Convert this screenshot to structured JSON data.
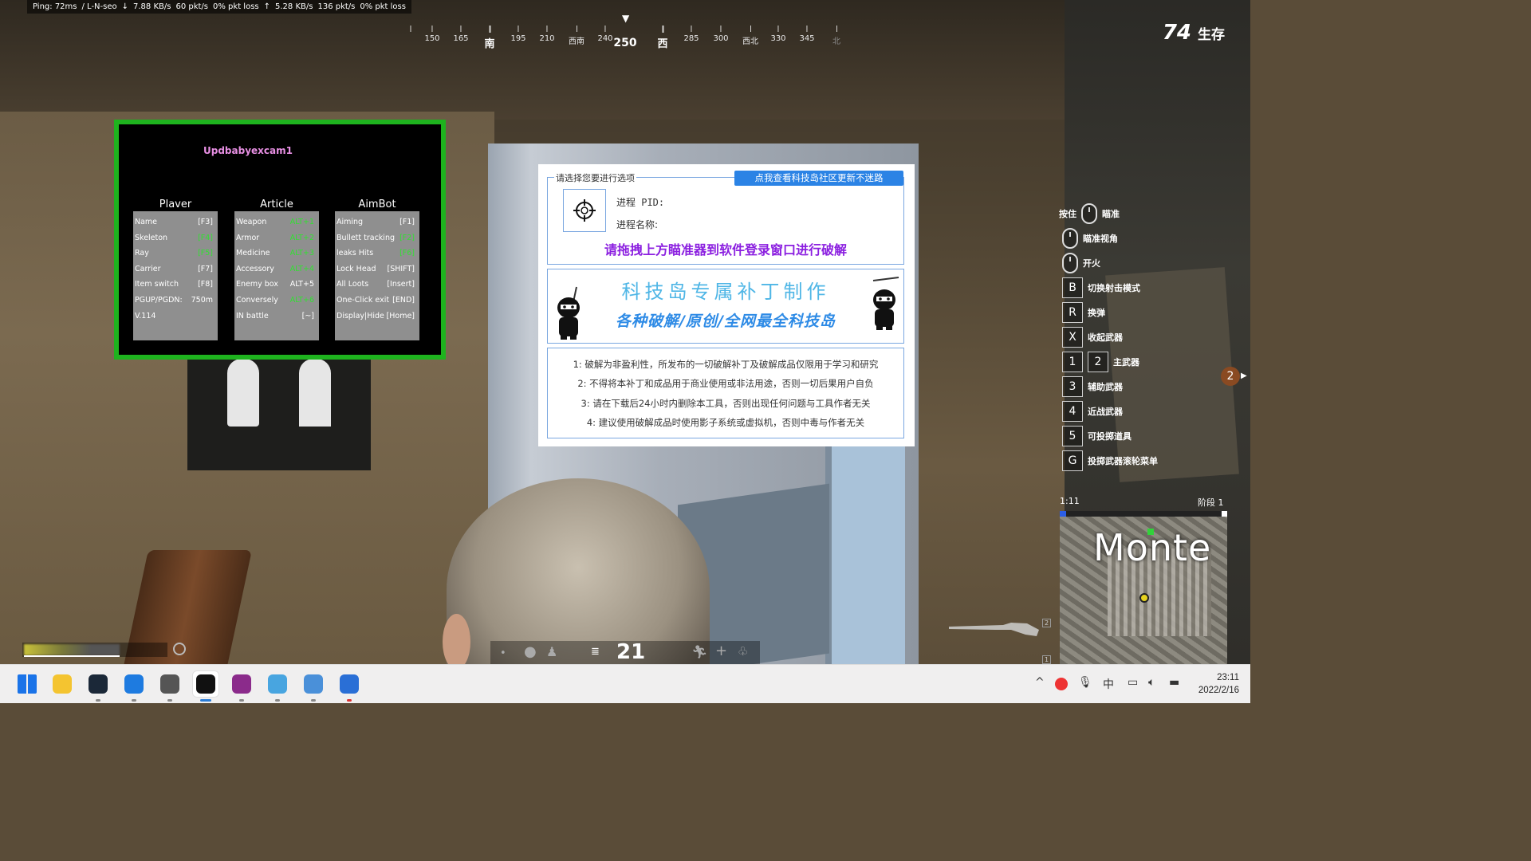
{
  "netstats": {
    "ping": "Ping: 72ms",
    "region": "/ L-N-seo",
    "down_icon": "down-arrow-icon",
    "down_rate": "7.88 KB/s",
    "down_pkt": "60 pkt/s",
    "down_loss": "0% pkt loss",
    "up_icon": "up-arrow-icon",
    "up_rate": "5.28 KB/s",
    "up_pkt": "136 pkt/s",
    "up_loss": "0% pkt loss"
  },
  "compass": {
    "heading": "250",
    "ticks": [
      {
        "label": "",
        "faded": true
      },
      {
        "label": "150"
      },
      {
        "label": "165"
      },
      {
        "label": "南",
        "major": true
      },
      {
        "label": "195"
      },
      {
        "label": "210"
      },
      {
        "label": "西南"
      },
      {
        "label": "240"
      },
      {
        "label": "西",
        "major": true
      },
      {
        "label": "285"
      },
      {
        "label": "300"
      },
      {
        "label": "西北"
      },
      {
        "label": "330"
      },
      {
        "label": "345"
      },
      {
        "label": "北",
        "faded": true
      }
    ]
  },
  "alive": {
    "count": "74",
    "label": "生存"
  },
  "cheat_menu": {
    "title": "Updbabyexcam1",
    "accent": "#1eb31e",
    "columns": [
      {
        "header": "Plaver",
        "rows": [
          {
            "name": "Name",
            "key": "[F3]",
            "green": false
          },
          {
            "name": "Skeleton",
            "key": "[F4]",
            "green": true
          },
          {
            "name": "Ray",
            "key": "[F5]",
            "green": true
          },
          {
            "name": "Carrier",
            "key": "[F7]",
            "green": false
          },
          {
            "name": "Item switch",
            "key": "[F8]",
            "green": false
          },
          {
            "name": "PGUP/PGDN:",
            "key": "750m",
            "green": false
          },
          {
            "name": "V.114",
            "key": "",
            "green": false
          }
        ]
      },
      {
        "header": "Article",
        "rows": [
          {
            "name": "Weapon",
            "key": "ALT+1",
            "green": true
          },
          {
            "name": "Armor",
            "key": "ALT+2",
            "green": true
          },
          {
            "name": "Medicine",
            "key": "ALT+3",
            "green": true
          },
          {
            "name": "Accessory",
            "key": "ALT+4",
            "green": true
          },
          {
            "name": "Enemy box",
            "key": "ALT+5",
            "green": false
          },
          {
            "name": "Conversely",
            "key": "ALT+6",
            "green": true
          },
          {
            "name": "IN battle",
            "key": "[~]",
            "green": false
          }
        ]
      },
      {
        "header": "AimBot",
        "rows": [
          {
            "name": "Aiming",
            "key": "[F1]",
            "green": false
          },
          {
            "name": "Bullett tracking",
            "key": "[F2]",
            "green": true
          },
          {
            "name": "leaks Hits",
            "key": "[F6]",
            "green": true
          },
          {
            "name": "Lock Head",
            "key": "[SHIFT]",
            "green": false
          },
          {
            "name": "All Loots",
            "key": "[Insert]",
            "green": false
          },
          {
            "name": "One-Click exit",
            "key": "[END]",
            "green": false
          },
          {
            "name": "Display|Hide",
            "key": "[Home]",
            "green": false
          }
        ]
      }
    ]
  },
  "crack_tool": {
    "legend": "请选择您要进行选项",
    "updates_button": "点我查看科技岛社区更新不迷路",
    "target_icon": "crosshair-icon",
    "pid_label": "进程 PID:",
    "pname_label": "进程名称:",
    "drag_hint": "请拖拽上方瞄准器到软件登录窗口进行破解",
    "banner_title": "科技岛专属补丁制作",
    "banner_subtitle": "各种破解/原创/全网最全科技岛",
    "notices": [
      "1: 破解为非盈利性，所发布的一切破解补丁及破解成品仅限用于学习和研究",
      "2: 不得将本补丁和成品用于商业使用或非法用途，否则一切后果用户自负",
      "3: 请在下载后24小时内删除本工具，否则出现任何问题与工具作者无关",
      "4: 建议使用破解成品时使用影子系统或虚拟机，否则中毒与作者无关"
    ]
  },
  "key_hints": [
    {
      "prefix": "按住",
      "keys": [
        "mouse-right"
      ],
      "label": "瞄准"
    },
    {
      "prefix": "",
      "keys": [
        "mouse-right"
      ],
      "label": "瞄准视角"
    },
    {
      "prefix": "",
      "keys": [
        "mouse-left"
      ],
      "label": "开火"
    },
    {
      "prefix": "",
      "keys": [
        "B"
      ],
      "label": "切换射击模式"
    },
    {
      "prefix": "",
      "keys": [
        "R"
      ],
      "label": "换弹"
    },
    {
      "prefix": "",
      "keys": [
        "X"
      ],
      "label": "收起武器"
    },
    {
      "prefix": "",
      "keys": [
        "1",
        "2"
      ],
      "label": "主武器"
    },
    {
      "prefix": "",
      "keys": [
        "3"
      ],
      "label": "辅助武器"
    },
    {
      "prefix": "",
      "keys": [
        "4"
      ],
      "label": "近战武器"
    },
    {
      "prefix": "",
      "keys": [
        "5"
      ],
      "label": "可投掷道具"
    },
    {
      "prefix": "",
      "keys": [
        "G"
      ],
      "label": "投掷武器滚轮菜单"
    }
  ],
  "side_badge": "2",
  "minimap": {
    "time": "1:11",
    "phase": "阶段 1",
    "location": "Monte"
  },
  "hud": {
    "ammo": "21",
    "weapon_slot_1": "2",
    "weapon_slot_2": "1"
  },
  "taskbar": {
    "apps": [
      {
        "name": "windows-start-icon",
        "color": "#1a73e8"
      },
      {
        "name": "file-explorer-icon",
        "color": "#f4c430"
      },
      {
        "name": "steam-icon",
        "color": "#1b2838"
      },
      {
        "name": "sogou-browser-icon",
        "color": "#1e7be0"
      },
      {
        "name": "pubg-helmet-icon",
        "color": "#555555"
      },
      {
        "name": "qq-penguin-icon",
        "color": "#111111"
      },
      {
        "name": "winrar-icon",
        "color": "#8b2b8b"
      },
      {
        "name": "star-app-icon",
        "color": "#48a5e0"
      },
      {
        "name": "monitor-app-icon",
        "color": "#4a90d9"
      },
      {
        "name": "cloud-app-icon",
        "color": "#2a6fd6"
      }
    ],
    "tray": {
      "chevron": "^",
      "ime": "中"
    },
    "time": "23:11",
    "date": "2022/2/16"
  }
}
